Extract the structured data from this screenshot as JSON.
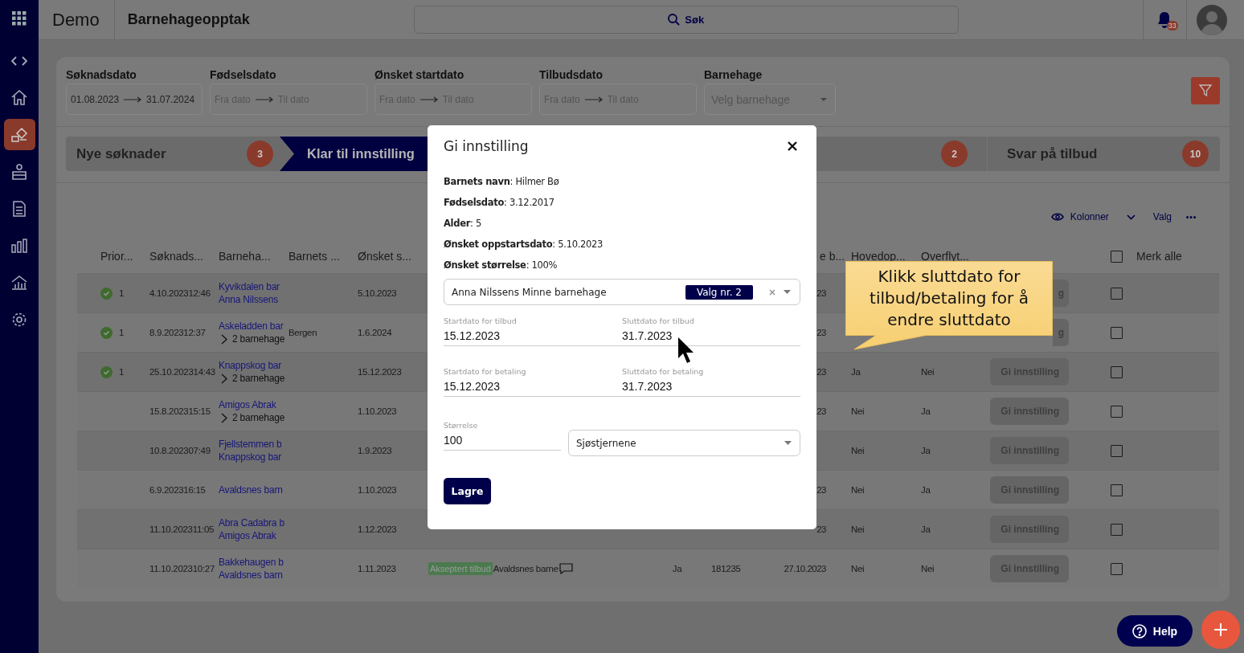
{
  "app": {
    "name": "Demo",
    "module": "Barnehageopptak"
  },
  "search": {
    "placeholder": "Søk"
  },
  "notifications": {
    "count": "33"
  },
  "sidebar": {
    "items": [
      {
        "kind": "apps",
        "selected": false
      },
      {
        "kind": "code",
        "selected": false
      },
      {
        "kind": "home",
        "selected": false
      },
      {
        "kind": "blocks",
        "selected": true
      },
      {
        "kind": "desk",
        "selected": false
      },
      {
        "kind": "document",
        "selected": false
      },
      {
        "kind": "bar-chart",
        "selected": false
      },
      {
        "kind": "house-chart",
        "selected": false
      },
      {
        "kind": "settings",
        "selected": false
      }
    ]
  },
  "filters": [
    {
      "kind": "range",
      "label": "Søknadsdato",
      "from": {
        "value": "01.08.2023"
      },
      "to": {
        "value": "31.07.2024"
      }
    },
    {
      "kind": "range",
      "label": "Fødselsdato",
      "from": {
        "placeholder": "Fra dato"
      },
      "to": {
        "placeholder": "Til dato"
      }
    },
    {
      "kind": "range",
      "label": "Ønsket startdato",
      "from": {
        "placeholder": "Fra dato"
      },
      "to": {
        "placeholder": "Til dato"
      }
    },
    {
      "kind": "range",
      "label": "Tilbudsdato",
      "from": {
        "placeholder": "Fra dato"
      },
      "to": {
        "placeholder": "Til dato"
      }
    },
    {
      "kind": "select",
      "label": "Barnehage",
      "placeholder": "Velg barnehage"
    }
  ],
  "steps": [
    {
      "label": "Nye søknader",
      "count": "3",
      "selected": false
    },
    {
      "label": "Klar til innstilling",
      "selected": true
    },
    {
      "count": "2",
      "selected": false
    },
    {
      "label": "Svar på tilbud",
      "count": "10",
      "selected": false
    }
  ],
  "toolbar": {
    "columns": "Kolonner",
    "options": "Valg"
  },
  "table": {
    "columns": [
      "Prior...",
      "Søknads...",
      "Barneha...",
      "Barnets ...",
      "Ønsket s...",
      "e b...",
      "Hovedop...",
      "Overflyt..."
    ],
    "select_all": {
      "label": "Merk alle",
      "checked": false
    },
    "rows": [
      {
        "approved": true,
        "priority": "1",
        "applied": "4.10.202312:46",
        "kindergartens": [
          {
            "kind": "link",
            "name": "Kyvikdalen bar"
          },
          {
            "kind": "link",
            "name": "Anna Nilssens"
          }
        ],
        "start": "5.10.2023",
        "column_9": "23",
        "action": "g",
        "action_clipped": true,
        "checked": false
      },
      {
        "approved": true,
        "priority": "1",
        "applied": "8.9.202312:37",
        "kindergartens": [
          {
            "kind": "link",
            "name": "Askeladden bar"
          },
          {
            "kind": "more",
            "name": "2 barnehage"
          }
        ],
        "city": "Bergen",
        "start": "1.6.2024",
        "column_9": "23",
        "action": "g",
        "action_clipped": true,
        "checked": false
      },
      {
        "approved": true,
        "priority": "1",
        "applied": "25.10.202314:43",
        "kindergartens": [
          {
            "kind": "link",
            "name": "Knappskog bar"
          },
          {
            "kind": "more",
            "name": "2 barnehage"
          }
        ],
        "start": "15.12.2023",
        "column_9": "23",
        "main": "Ja",
        "transfer": "Nei",
        "action": "Gi innstilling",
        "checked": false
      },
      {
        "approved": false,
        "applied": "15.8.202315:15",
        "kindergartens": [
          {
            "kind": "link",
            "name": "Amigos Abrak"
          },
          {
            "kind": "more",
            "name": "2 barnehage"
          }
        ],
        "start": "1.10.2023",
        "column_9": "23",
        "main": "Nei",
        "transfer": "Ja",
        "action": "Gi innstilling",
        "checked": false
      },
      {
        "approved": false,
        "applied": "10.8.202307:49",
        "kindergartens": [
          {
            "kind": "link",
            "name": "Fjellstemmen b"
          },
          {
            "kind": "link",
            "name": "Knappskog bar"
          }
        ],
        "start": "1.9.2023",
        "main": "Nei",
        "transfer": "Ja",
        "action": "Gi innstilling",
        "checked": false
      },
      {
        "approved": false,
        "applied": "6.9.202316:15",
        "kindergartens": [
          {
            "kind": "link",
            "name": "Avaldsnes barn"
          }
        ],
        "start": "1.10.2023",
        "column_9": "23",
        "main": "Nei",
        "transfer": "Ja",
        "action": "Gi innstilling",
        "checked": false
      },
      {
        "approved": false,
        "applied": "11.10.202311:05",
        "kindergartens": [
          {
            "kind": "link",
            "name": "Abra Cadabra b"
          },
          {
            "kind": "link",
            "name": "Amigos Abrak"
          }
        ],
        "start": "1.12.2023",
        "column_9": "23",
        "main": "Nei",
        "transfer": "Ja",
        "action": "Gi innstilling",
        "checked": false
      },
      {
        "approved": false,
        "applied": "11.10.202310:27",
        "kindergartens": [
          {
            "kind": "link",
            "name": "Bakkehaugen b"
          },
          {
            "kind": "link",
            "name": "Avaldsnes barn"
          }
        ],
        "start": "1.11.2023",
        "status": "Akseptert tilbud",
        "offer": "Avaldsnes barne",
        "comment": true,
        "column_7": "Ja",
        "column_8": "181235",
        "column_9": "27.10.2023",
        "main": "Nei",
        "transfer": "Nei",
        "action": "Gi innstilling",
        "checked": false
      }
    ]
  },
  "modal": {
    "title": "Gi innstilling",
    "facts": [
      "**Barnets navn**: Hilmer Bø",
      "**Fødselsdato**: 3.12.2017",
      "**Alder**: 5",
      "**Ønsket oppstartsdato**: 5.10.2023",
      "**Ønsket størrelse**: 100%"
    ],
    "kindergarten": {
      "value": "Anna Nilssens Minne barnehage",
      "tag": "Valg nr. 2"
    },
    "dates": [
      {
        "label": "Startdato for tilbud",
        "value": "15.12.2023"
      },
      {
        "label": "Sluttdato for tilbud",
        "value": "31.7.2023"
      },
      {
        "label": "Startdato for betaling",
        "value": "15.12.2023"
      },
      {
        "label": "Sluttdato for betaling",
        "value": "31.7.2023"
      }
    ],
    "size": {
      "label": "Størrelse",
      "value": "100"
    },
    "group": {
      "value": "Sjøstjernene"
    },
    "save": "Lagre"
  },
  "callout": {
    "text": "Klikk sluttdato for tilbud/betaling for å endre sluttdato"
  },
  "help": {
    "label": "Help"
  }
}
